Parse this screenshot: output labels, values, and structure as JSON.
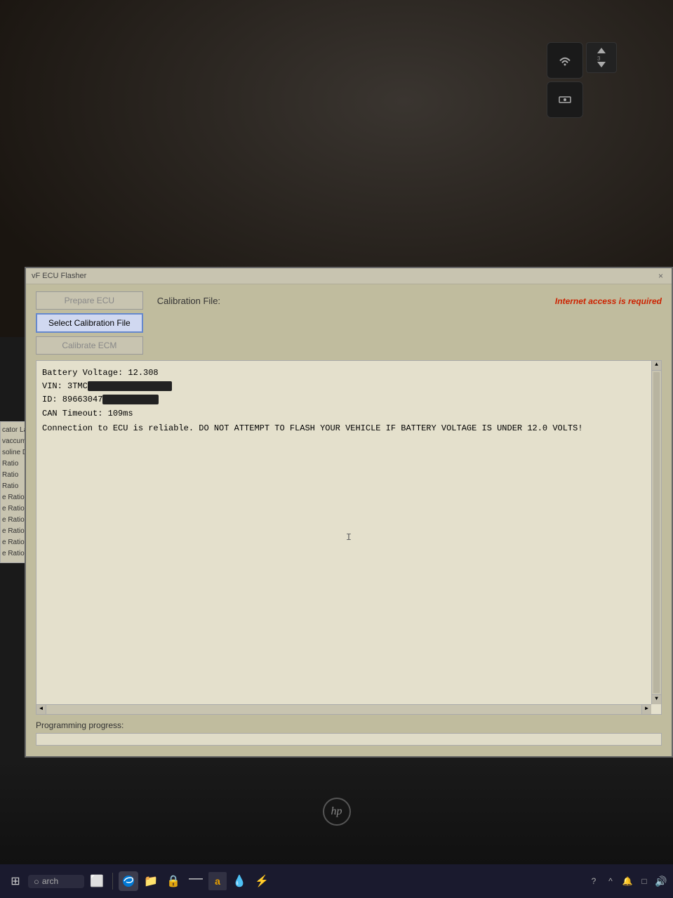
{
  "window": {
    "title": "vF ECU Flasher",
    "close_label": "×"
  },
  "buttons": {
    "prepare_ecu": "Prepare ECU",
    "select_calibration": "Select Calibration File",
    "calibrate_ecm": "Calibrate ECM"
  },
  "calibration": {
    "label": "Calibration File:",
    "value": ""
  },
  "internet_warning": "Internet access is required",
  "info_text": {
    "line1": "Battery Voltage: 12.308",
    "line2": "VIN: 3TMC",
    "line3": "ID: 89663047",
    "line4": "CAN Timeout: 109ms",
    "line5": "Connection to ECU is reliable. DO NOT ATTEMPT TO FLASH YOUR VEHICLE IF BATTERY VOLTAGE IS UNDER 12.0 VOLTS!"
  },
  "progress": {
    "label": "Programming progress:"
  },
  "sidebar_items": [
    "cator Lamp (M",
    "vaccum)",
    "soline Direct In",
    "Ratio",
    "Ratio",
    "Ratio",
    "e Ratio",
    "e Ratio",
    "e Ratio",
    "e Ratio",
    "e Ratio",
    "e Ratio"
  ],
  "taskbar": {
    "search_placeholder": "arch",
    "icons": [
      "⊞",
      "⬛",
      "🌐",
      "📁",
      "🔒",
      "—",
      "a",
      "💧",
      "⚡"
    ],
    "right_icons": [
      "?",
      "^",
      "🔔",
      "□",
      "🔊"
    ]
  }
}
